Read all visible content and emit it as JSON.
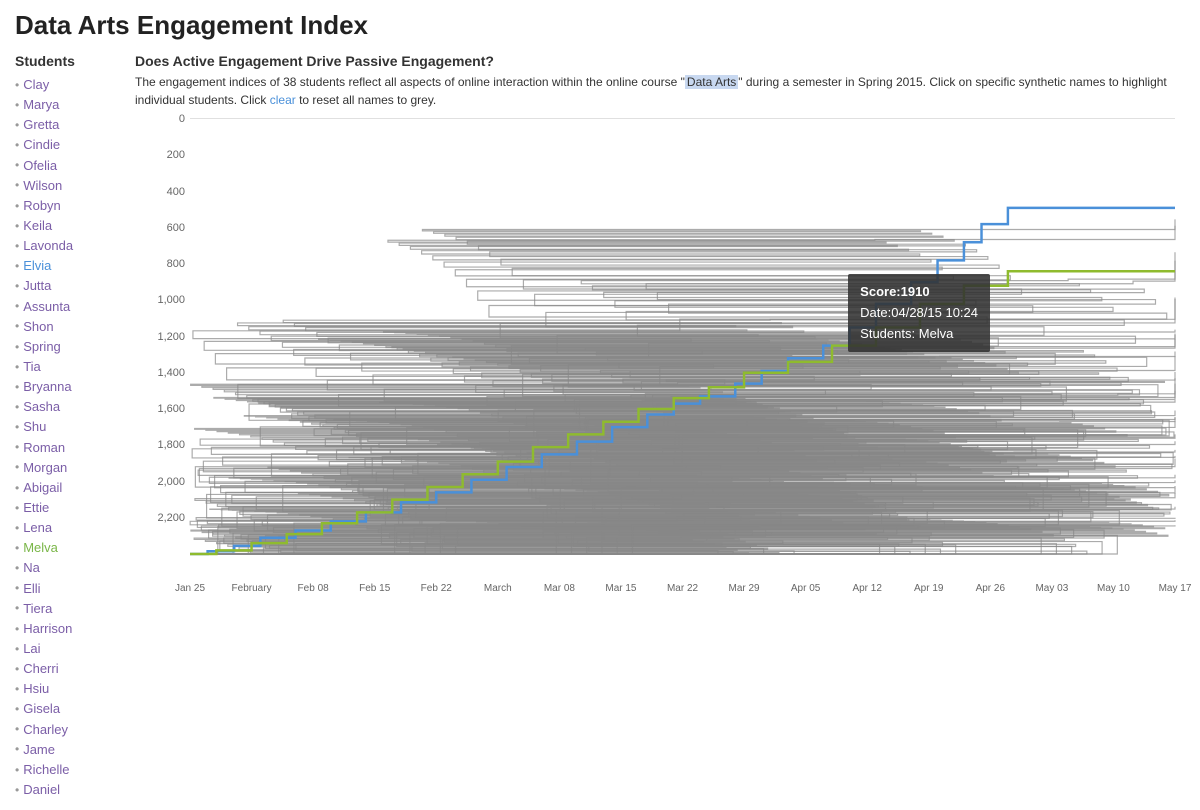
{
  "page": {
    "title": "Data Arts Engagement Index"
  },
  "sidebar": {
    "heading": "Students",
    "students": [
      {
        "name": "Clay",
        "state": "normal"
      },
      {
        "name": "Marya",
        "state": "normal"
      },
      {
        "name": "Gretta",
        "state": "normal"
      },
      {
        "name": "Cindie",
        "state": "normal"
      },
      {
        "name": "Ofelia",
        "state": "normal"
      },
      {
        "name": "Wilson",
        "state": "normal"
      },
      {
        "name": "Robyn",
        "state": "normal"
      },
      {
        "name": "Keila",
        "state": "normal"
      },
      {
        "name": "Lavonda",
        "state": "normal"
      },
      {
        "name": "Elvia",
        "state": "highlighted"
      },
      {
        "name": "Jutta",
        "state": "normal"
      },
      {
        "name": "Assunta",
        "state": "normal"
      },
      {
        "name": "Shon",
        "state": "normal"
      },
      {
        "name": "Spring",
        "state": "normal"
      },
      {
        "name": "Tia",
        "state": "normal"
      },
      {
        "name": "Bryanna",
        "state": "normal"
      },
      {
        "name": "Sasha",
        "state": "normal"
      },
      {
        "name": "Shu",
        "state": "normal"
      },
      {
        "name": "Roman",
        "state": "normal"
      },
      {
        "name": "Morgan",
        "state": "normal"
      },
      {
        "name": "Abigail",
        "state": "normal"
      },
      {
        "name": "Ettie",
        "state": "normal"
      },
      {
        "name": "Lena",
        "state": "normal"
      },
      {
        "name": "Melva",
        "state": "highlighted-green"
      },
      {
        "name": "Na",
        "state": "normal"
      },
      {
        "name": "Elli",
        "state": "normal"
      },
      {
        "name": "Tiera",
        "state": "normal"
      },
      {
        "name": "Harrison",
        "state": "normal"
      },
      {
        "name": "Lai",
        "state": "normal"
      },
      {
        "name": "Cherri",
        "state": "normal"
      },
      {
        "name": "Hsiu",
        "state": "normal"
      },
      {
        "name": "Gisela",
        "state": "normal"
      },
      {
        "name": "Charley",
        "state": "normal"
      },
      {
        "name": "Jame",
        "state": "normal"
      },
      {
        "name": "Richelle",
        "state": "normal"
      },
      {
        "name": "Daniel",
        "state": "normal"
      }
    ]
  },
  "description": {
    "heading": "Does Active Engagement Drive Passive Engagement?",
    "text_before": "The engagement indices of 38 students reflect all aspects of online interaction within the online course \"",
    "highlight": "Data Arts",
    "text_after": "\" during a semester in Spring 2015. Click on specific synthetic names to highlight individual students. Click ",
    "clear_link": "clear",
    "text_end": " to reset all names to grey."
  },
  "chart": {
    "y_labels": [
      "0",
      "200",
      "400",
      "600",
      "800",
      "1,000",
      "1,200",
      "1,400",
      "1,600",
      "1,800",
      "2,000",
      "2,200"
    ],
    "x_labels": [
      "Jan 25",
      "February",
      "Feb 08",
      "Feb 15",
      "Feb 22",
      "March",
      "Mar 08",
      "Mar 15",
      "Mar 22",
      "Mar 29",
      "Apr 05",
      "Apr 12",
      "Apr 19",
      "Apr 26",
      "May 03",
      "May 10",
      "May 17"
    ]
  },
  "tooltip": {
    "score_label": "Score:",
    "score_value": "1910",
    "date_label": "Date:",
    "date_value": "04/28/15 10:24",
    "students_label": "Students:",
    "students_value": "Melva"
  }
}
